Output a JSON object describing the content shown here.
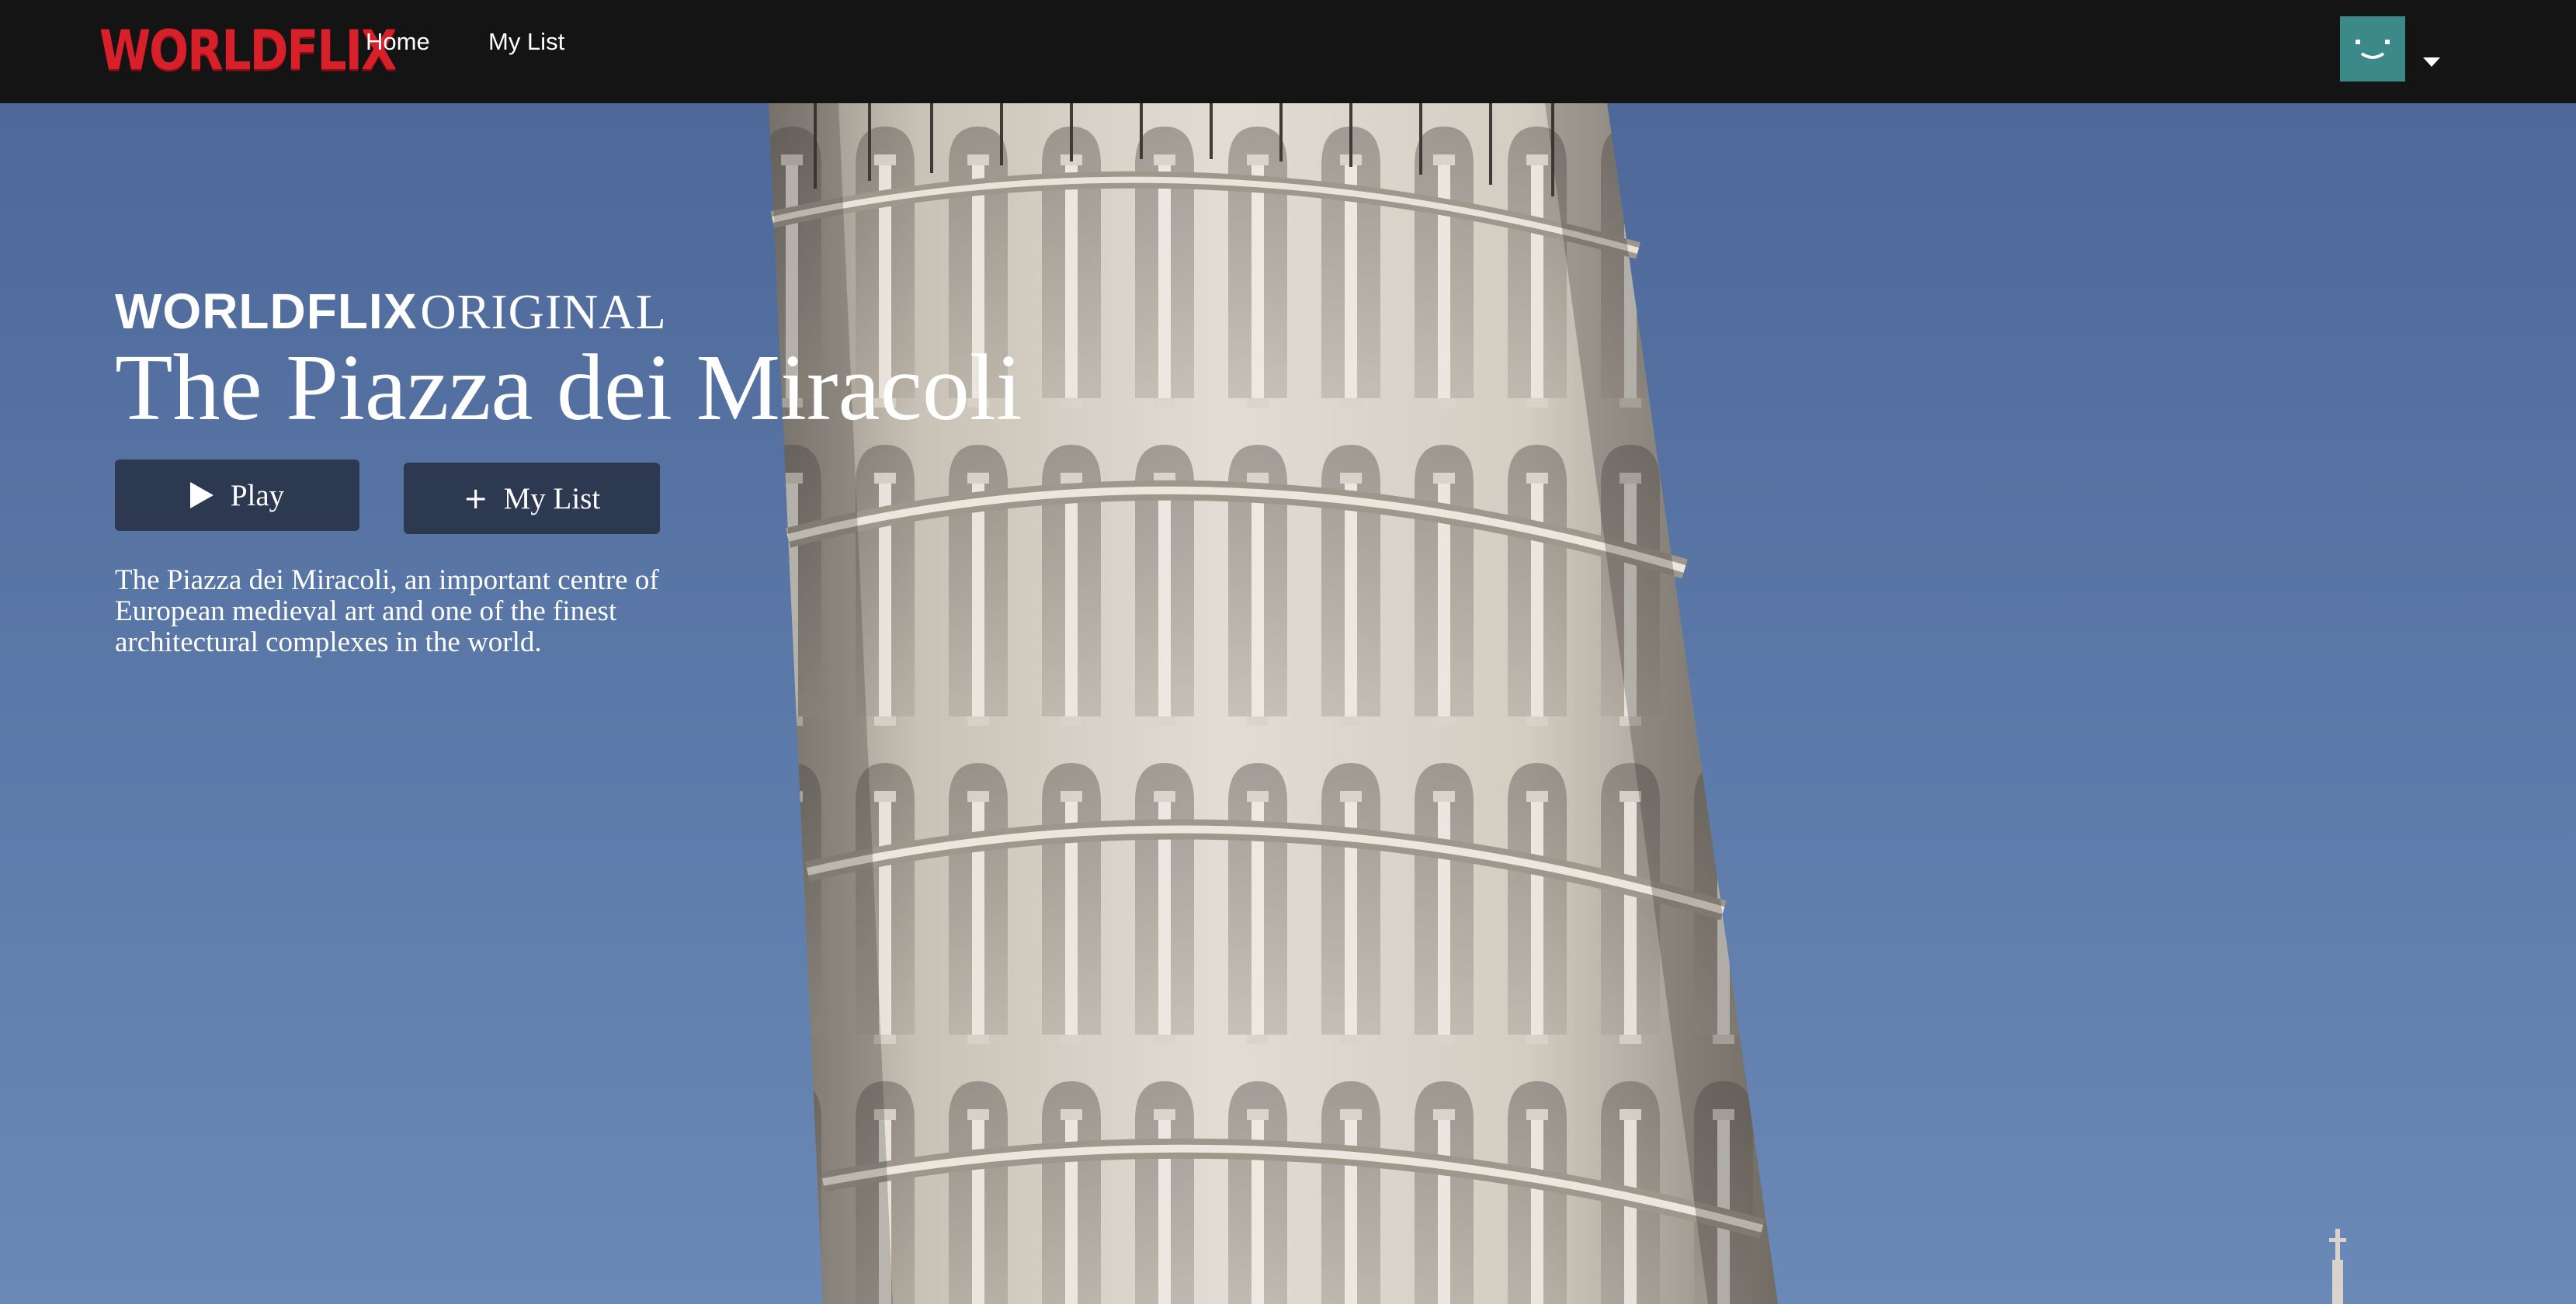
{
  "nav": {
    "logo": "WORLDFLIX",
    "links": [
      {
        "label": "Home"
      },
      {
        "label": "My List"
      }
    ],
    "avatar_color": "#3b8a89"
  },
  "hero": {
    "brand_strong": "WORLDFLIX",
    "brand_light": "ORIGINAL",
    "title": "The Piazza dei Miracoli",
    "play_label": "Play",
    "mylist_label": "My List",
    "description": "The Piazza dei Miracoli, an important centre of European medieval art and one of the finest architectural complexes in the world."
  },
  "colors": {
    "nav_background": "#141414",
    "logo_red": "#d8202a",
    "button_background": "#2a344a",
    "sky": "#5d7cab"
  },
  "icons": {
    "play": "play-icon",
    "add": "plus-icon",
    "dropdown": "caret-down-icon",
    "avatar": "smiley-avatar-icon"
  }
}
